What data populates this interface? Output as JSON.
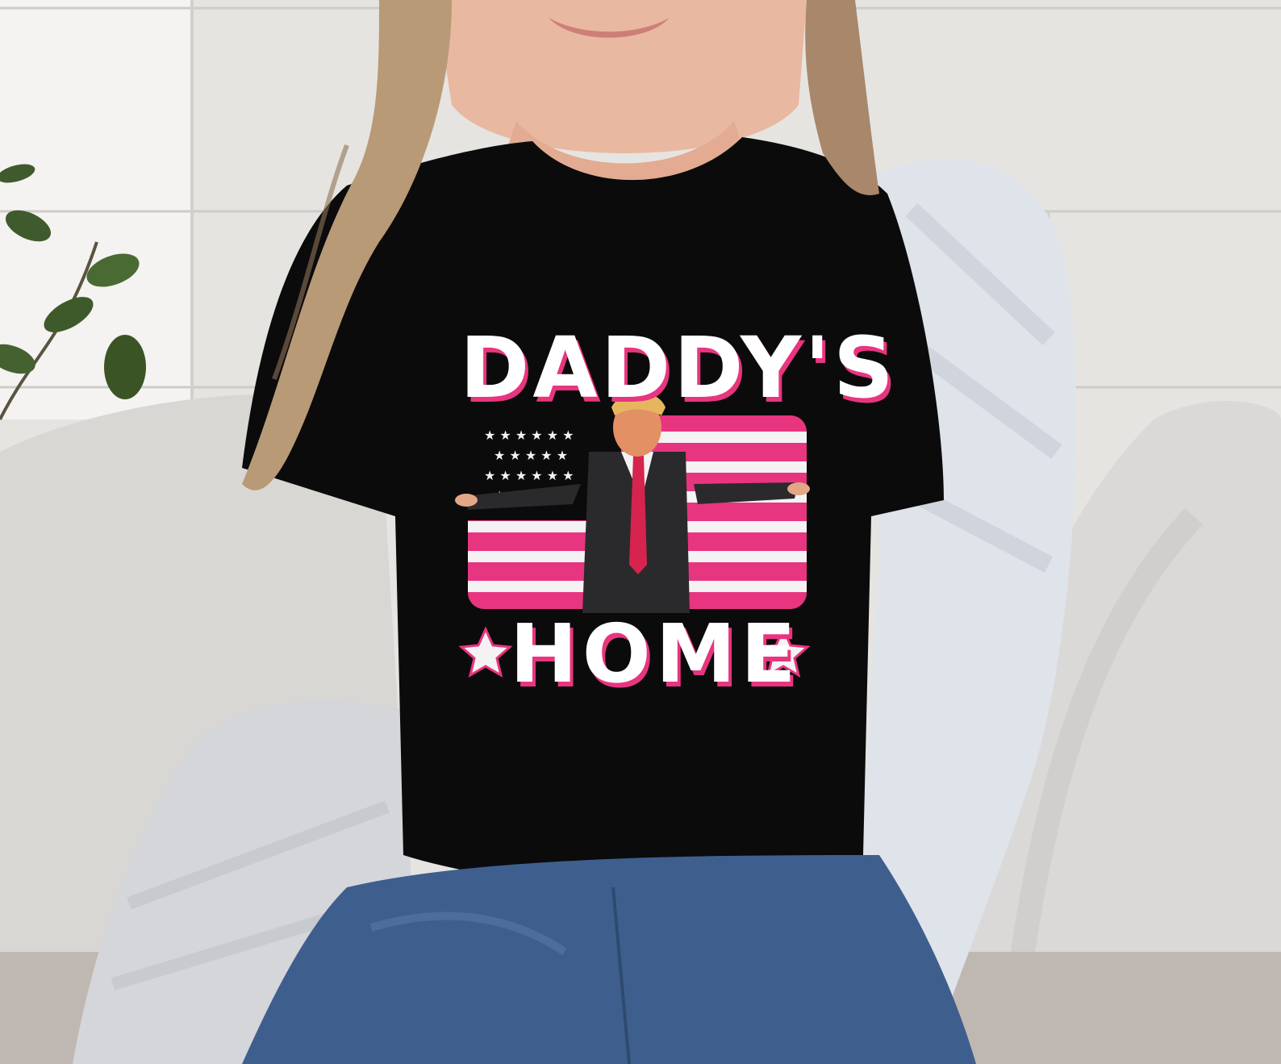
{
  "shirt_print": {
    "line1": "DADDY'S",
    "line2": "HOME"
  },
  "colors": {
    "wall": "#e6e4e1",
    "shirt": "#0b0b0c",
    "flag_pink": "#e8357f",
    "flag_white": "#f4f2f3",
    "hair": "#b99a76",
    "skin": "#e9b8a0",
    "jeans": "#3e5f8e",
    "cardigan": "#dfe3ea",
    "pillow": "#d9d8d6",
    "suit": "#2a2a2c",
    "tie": "#d6244f"
  },
  "icons": [
    "star-icon",
    "star-icon",
    "flag-graphic",
    "plant-leaves"
  ]
}
